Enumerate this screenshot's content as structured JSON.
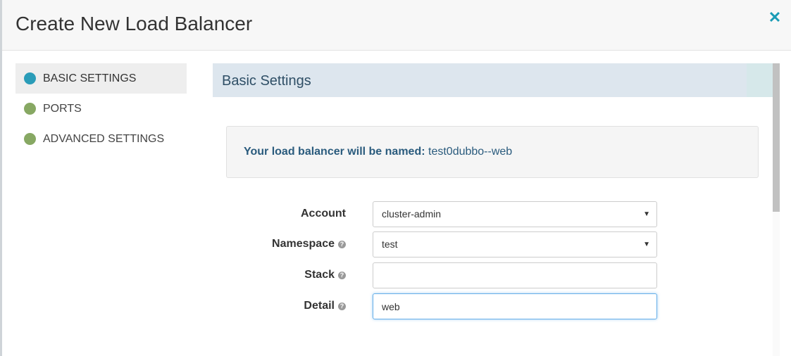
{
  "modal": {
    "title": "Create New Load Balancer",
    "close_icon": "close-icon"
  },
  "sidebar": {
    "items": [
      {
        "label": "BASIC SETTINGS",
        "active": true,
        "color": "#2a9cb8"
      },
      {
        "label": "PORTS",
        "active": false,
        "color": "#87a863"
      },
      {
        "label": "ADVANCED SETTINGS",
        "active": false,
        "color": "#87a863"
      }
    ]
  },
  "section": {
    "title": "Basic Settings"
  },
  "naming": {
    "label": "Your load balancer will be named:",
    "value": "test0dubbo--web"
  },
  "form": {
    "account": {
      "label": "Account",
      "value": "cluster-admin"
    },
    "namespace": {
      "label": "Namespace",
      "value": "test"
    },
    "stack": {
      "label": "Stack",
      "value": ""
    },
    "detail": {
      "label": "Detail",
      "value": "web"
    }
  },
  "colors": {
    "accent": "#1a9bb5",
    "heading": "#2f4f66"
  }
}
